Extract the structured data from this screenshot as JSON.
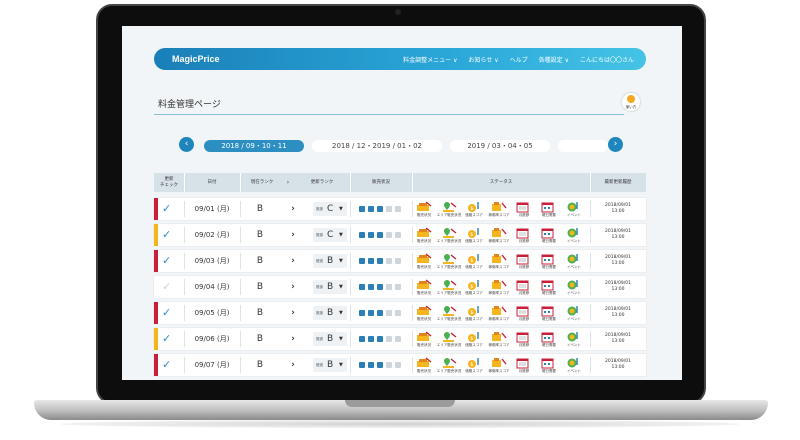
{
  "app": {
    "logo": "MagicPrice"
  },
  "nav": [
    {
      "label": "料金調整メニュー ∨"
    },
    {
      "label": "お知らせ ∨"
    },
    {
      "label": "ヘルプ"
    },
    {
      "label": "各種設定 ∨"
    },
    {
      "label": "こんにちは〇〇さん"
    }
  ],
  "page": {
    "title": "料金管理ページ",
    "help_label": "使い方"
  },
  "dates": {
    "prev": "‹",
    "next": "›",
    "ranges": [
      "2018 / 09・10・11",
      "2018 / 12・2019 / 01・02",
      "2019 / 03・04・05",
      ""
    ]
  },
  "table": {
    "headers": {
      "update_check": "更新\nチェック",
      "date": "日付",
      "current_rank": "現在ランク",
      "new_rank": "更新ランク",
      "sales": "販売状況",
      "status": "ステータス",
      "last_update": "最新更新履歴"
    },
    "rank_label": "推奨",
    "status_labels": [
      "販売状況",
      "エリア販売状況",
      "価格スコア",
      "稼働率スコア",
      "月推移",
      "曜日需要",
      "イベント"
    ],
    "colors": {
      "red": "#c8203a",
      "yellow": "#f4b51e",
      "blue": "#2a7fb6",
      "grey": "#cfd6db"
    },
    "rows": [
      {
        "date": "09/01 (月)",
        "current": "B",
        "new": "C",
        "bar": "red",
        "checked": true,
        "filled": 3,
        "update": "2018/09/01\n13:00"
      },
      {
        "date": "09/02 (月)",
        "current": "B",
        "new": "C",
        "bar": "yellow",
        "checked": true,
        "filled": 3,
        "update": "2018/09/01\n13:00"
      },
      {
        "date": "09/03 (月)",
        "current": "B",
        "new": "B",
        "bar": "red",
        "checked": true,
        "filled": 3,
        "update": "2018/09/01\n13:00"
      },
      {
        "date": "09/04 (月)",
        "current": "B",
        "new": "B",
        "bar": "none",
        "checked": false,
        "filled": 3,
        "update": "2018/09/01\n13:00"
      },
      {
        "date": "09/05 (月)",
        "current": "B",
        "new": "B",
        "bar": "red",
        "checked": true,
        "filled": 3,
        "update": "2018/09/01\n13:00"
      },
      {
        "date": "09/06 (月)",
        "current": "B",
        "new": "B",
        "bar": "yellow",
        "checked": true,
        "filled": 3,
        "update": "2018/09/01\n13:00"
      },
      {
        "date": "09/07 (月)",
        "current": "B",
        "new": "B",
        "bar": "red",
        "checked": true,
        "filled": 3,
        "update": "2018/09/01\n13:00"
      }
    ]
  }
}
